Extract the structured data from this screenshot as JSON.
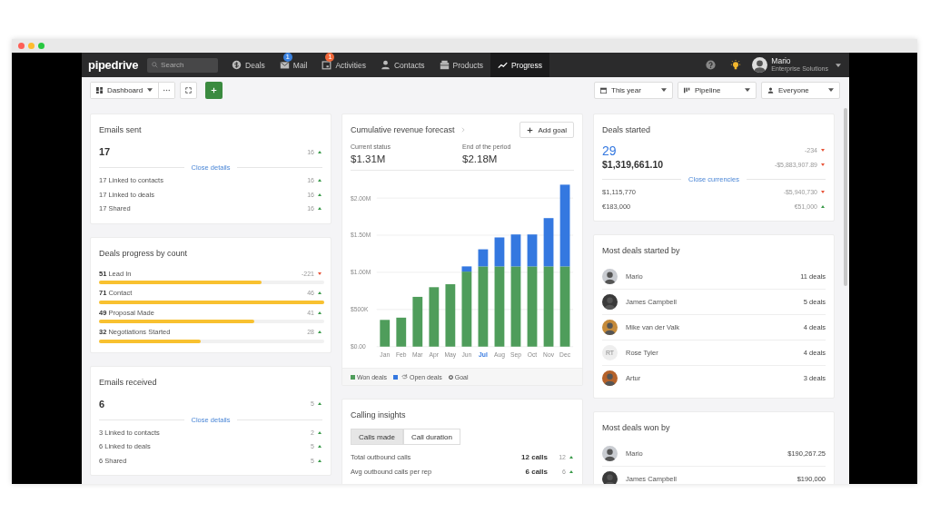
{
  "nav": {
    "logo": "pipedrive",
    "search": {
      "placeholder": "Search"
    },
    "items": [
      {
        "label": "Deals",
        "selected": false
      },
      {
        "label": "Mail",
        "selected": false,
        "badge": {
          "text": "1",
          "color": "#3b82e0"
        }
      },
      {
        "label": "Activities",
        "selected": false,
        "badge": {
          "text": "1",
          "color": "#f0673a"
        }
      },
      {
        "label": "Contacts",
        "selected": false
      },
      {
        "label": "Products",
        "selected": false
      },
      {
        "label": "Progress",
        "selected": true
      }
    ],
    "user": {
      "name": "Mario",
      "company": "Enterprise Solutions"
    }
  },
  "toolbar": {
    "dashboard": "Dashboard",
    "filters": [
      {
        "label": "This year"
      },
      {
        "label": "Pipeline"
      },
      {
        "label": "Everyone"
      }
    ]
  },
  "columns": [
    [
      {
        "kind": "stat",
        "title": "Emails sent",
        "value": "17",
        "change": "16",
        "rising": true,
        "link": "Close details",
        "rows": [
          {
            "label": "17 Linked to contacts",
            "change": "16",
            "rising": true
          },
          {
            "label": "17 Linked to deals",
            "change": "16",
            "rising": true
          },
          {
            "label": "17 Shared",
            "change": "16",
            "rising": true
          }
        ]
      },
      {
        "kind": "progress",
        "title": "Deals progress by count",
        "rows": [
          {
            "count": "51",
            "label": "Lead In",
            "change": "-221",
            "rising": false,
            "level": 0.72
          },
          {
            "count": "71",
            "label": "Contact",
            "change": "46",
            "rising": true,
            "level": 1
          },
          {
            "count": "49",
            "label": "Proposal Made",
            "change": "41",
            "rising": true,
            "level": 0.69
          },
          {
            "count": "32",
            "label": "Negotiations Started",
            "change": "28",
            "rising": true,
            "level": 0.45
          }
        ]
      },
      {
        "kind": "stat",
        "title": "Emails received",
        "value": "6",
        "change": "5",
        "rising": true,
        "link": "Close details",
        "rows": [
          {
            "label": "3 Linked to contacts",
            "change": "2",
            "rising": true
          },
          {
            "label": "6 Linked to deals",
            "change": "5",
            "rising": true
          },
          {
            "label": "6 Shared",
            "change": "5",
            "rising": true
          }
        ]
      }
    ],
    [
      {
        "kind": "forecast",
        "title": "Cumulative revenue forecast",
        "button": "Add goal",
        "stats": [
          {
            "label": "Current status",
            "value": "$1.31M"
          },
          {
            "label": "End of the period",
            "value": "$2.18M"
          }
        ],
        "month_states": [
          {
            "selected": false
          },
          {
            "selected": false
          },
          {
            "selected": false
          },
          {
            "selected": false
          },
          {
            "selected": false
          },
          {
            "selected": false
          },
          {
            "selected": true
          },
          {
            "selected": false
          },
          {
            "selected": false
          },
          {
            "selected": false
          },
          {
            "selected": false
          },
          {
            "selected": false
          }
        ],
        "chart_data": {
          "type": "bar",
          "stacked": true,
          "grid": true,
          "categories": [
            "Jan",
            "Feb",
            "Mar",
            "Apr",
            "May",
            "Jun",
            "Jul",
            "Aug",
            "Sep",
            "Oct",
            "Nov",
            "Dec"
          ],
          "series": [
            {
              "name": "Won deals",
              "color": "#4f9d5b",
              "values": [
                360000,
                390000,
                670000,
                800000,
                840000,
                1010000,
                1080000,
                1080000,
                1080000,
                1080000,
                1080000,
                1080000
              ]
            },
            {
              "name": "Open deals",
              "color": "#3478e0",
              "values": [
                0,
                0,
                0,
                0,
                0,
                70000,
                230000,
                390000,
                430000,
                430000,
                650000,
                1100000
              ]
            }
          ],
          "ylim": [
            0,
            2200000
          ],
          "yticks": [
            {
              "value": 0,
              "label": "$0.00"
            },
            {
              "value": 500000,
              "label": "$500K"
            },
            {
              "value": 1000000,
              "label": "$1.00M"
            },
            {
              "value": 1500000,
              "label": "$1.50M"
            },
            {
              "value": 2000000,
              "label": "$2.00M"
            }
          ]
        },
        "goal_legend": "Goal"
      },
      {
        "kind": "calls",
        "title": "Calling insights",
        "tabs": [
          {
            "label": "Calls made",
            "selected": true
          },
          {
            "label": "Call duration",
            "selected": false
          }
        ],
        "rows": [
          {
            "label": "Total outbound calls",
            "value": "12 calls",
            "change": "12",
            "rising": true
          },
          {
            "label": "Avg outbound calls per rep",
            "value": "6 calls",
            "change": "6",
            "rising": true
          }
        ]
      }
    ],
    [
      {
        "kind": "currency",
        "title": "Deals started",
        "count": "29",
        "count_change": "-234",
        "count_rising": false,
        "amount": "$1,319,661.10",
        "amount_change": "-$5,883,907.89",
        "amount_rising": false,
        "link": "Close currencies",
        "rows": [
          {
            "label": "$1,115,770",
            "change": "-$5,940,730",
            "rising": false
          },
          {
            "label": "€183,000",
            "change": "€51,000",
            "rising": true
          }
        ]
      },
      {
        "kind": "people",
        "title": "Most deals started by",
        "rows": [
          {
            "name": "Mario",
            "value": "11 deals"
          },
          {
            "name": "James Campbell",
            "value": "5 deals"
          },
          {
            "name": "Mike van der Valk",
            "value": "4 deals"
          },
          {
            "name": "Rose Tyler",
            "value": "4 deals",
            "initials": "RT"
          },
          {
            "name": "Artur",
            "value": "3 deals"
          }
        ]
      },
      {
        "kind": "people",
        "title": "Most deals won by",
        "rows": [
          {
            "name": "Mario",
            "value": "$190,267.25"
          },
          {
            "name": "James Campbell",
            "value": "$190,000"
          }
        ]
      }
    ]
  ]
}
